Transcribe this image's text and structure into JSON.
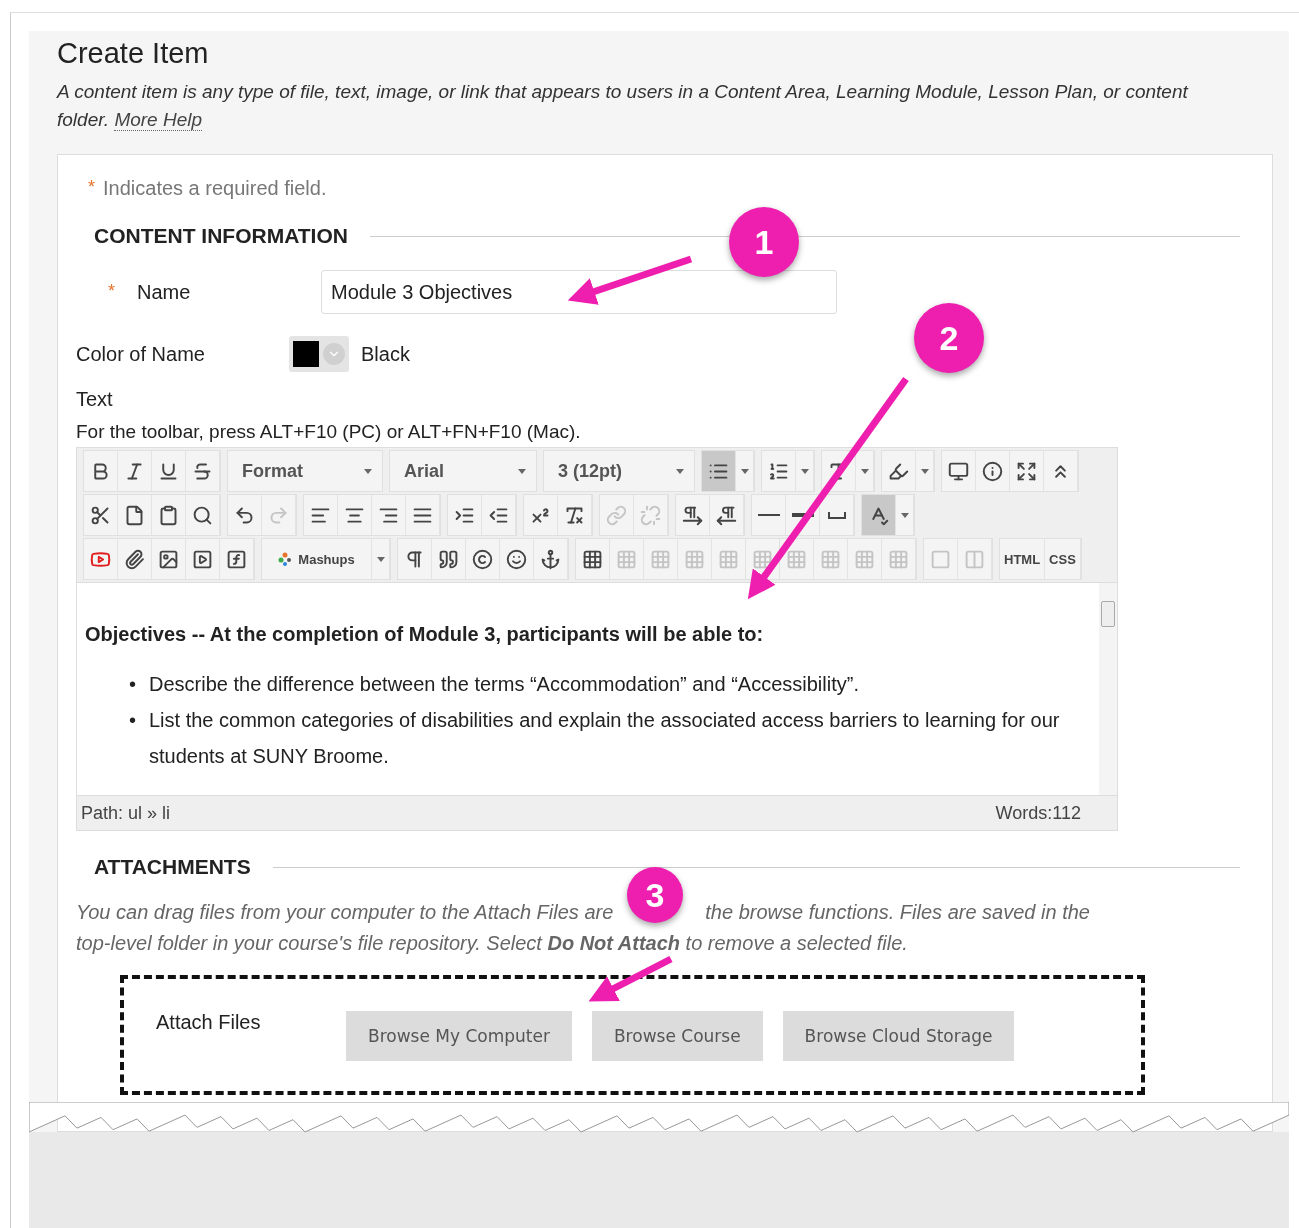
{
  "page": {
    "title": "Create Item",
    "description": "A content item is any type of file, text, image, or link that appears to users in a Content Area, Learning Module, Lesson Plan, or content folder.",
    "help_link": "More Help"
  },
  "form": {
    "required_note": {
      "mark": "*",
      "text": "Indicates a required field."
    },
    "content_section": {
      "heading": "CONTENT INFORMATION",
      "name_field": {
        "mark": "*",
        "label": "Name",
        "value": "Module 3 Objectives"
      },
      "color_field": {
        "label": "Color of Name",
        "color": "#000000",
        "value": "Black"
      },
      "text_field": {
        "label": "Text",
        "hint": "For the toolbar, press ALT+F10 (PC) or ALT+FN+F10 (Mac).",
        "toolbar": [
          [
            [
              {
                "kind": "icon",
                "disabled": false,
                "pressed": false
              },
              {
                "kind": "icon",
                "disabled": false,
                "pressed": false
              },
              {
                "kind": "icon",
                "disabled": false,
                "pressed": false
              },
              {
                "kind": "icon",
                "disabled": false,
                "pressed": false
              }
            ],
            [
              {
                "kind": "dropdown",
                "label": "Format"
              }
            ],
            [
              {
                "kind": "dropdown",
                "label": "Arial"
              }
            ],
            [
              {
                "kind": "dropdown",
                "label": "3 (12pt)"
              }
            ],
            [
              {
                "kind": "icon",
                "disabled": false,
                "pressed": true
              },
              {
                "kind": "caret"
              }
            ],
            [
              {
                "kind": "icon",
                "disabled": false,
                "pressed": false
              },
              {
                "kind": "caret"
              }
            ],
            [
              {
                "kind": "icon",
                "disabled": false,
                "pressed": false
              },
              {
                "kind": "caret"
              }
            ],
            [
              {
                "kind": "icon",
                "disabled": false,
                "pressed": false
              },
              {
                "kind": "caret"
              }
            ],
            [
              {
                "kind": "icon",
                "disabled": false,
                "pressed": false
              },
              {
                "kind": "icon",
                "disabled": false,
                "pressed": false
              },
              {
                "kind": "icon",
                "disabled": false,
                "pressed": false
              },
              {
                "kind": "icon",
                "disabled": false,
                "pressed": false
              }
            ]
          ],
          [
            [
              {
                "kind": "icon",
                "disabled": false,
                "pressed": false
              },
              {
                "kind": "icon",
                "disabled": false,
                "pressed": false
              },
              {
                "kind": "icon",
                "disabled": false,
                "pressed": false
              },
              {
                "kind": "icon",
                "disabled": false,
                "pressed": false
              }
            ],
            [
              {
                "kind": "icon",
                "disabled": false,
                "pressed": false
              },
              {
                "kind": "icon",
                "disabled": true,
                "pressed": false
              }
            ],
            [
              {
                "kind": "icon",
                "disabled": false,
                "pressed": false
              },
              {
                "kind": "icon",
                "disabled": false,
                "pressed": false
              },
              {
                "kind": "icon",
                "disabled": false,
                "pressed": false
              },
              {
                "kind": "icon",
                "disabled": false,
                "pressed": false
              }
            ],
            [
              {
                "kind": "icon",
                "disabled": false,
                "pressed": false
              },
              {
                "kind": "icon",
                "disabled": false,
                "pressed": false
              }
            ],
            [
              {
                "kind": "icon",
                "disabled": false,
                "pressed": false
              },
              {
                "kind": "icon",
                "disabled": false,
                "pressed": false
              }
            ],
            [
              {
                "kind": "icon",
                "disabled": true,
                "pressed": false
              },
              {
                "kind": "icon",
                "disabled": true,
                "pressed": false
              }
            ],
            [
              {
                "kind": "icon",
                "disabled": false,
                "pressed": false
              },
              {
                "kind": "icon",
                "disabled": false,
                "pressed": false
              }
            ],
            [
              {
                "kind": "icon",
                "disabled": false,
                "pressed": false
              },
              {
                "kind": "icon",
                "disabled": false,
                "pressed": false
              },
              {
                "kind": "icon",
                "disabled": false,
                "pressed": false
              }
            ],
            [
              {
                "kind": "icon",
                "disabled": false,
                "pressed": true
              },
              {
                "kind": "caret"
              }
            ]
          ],
          [
            [
              {
                "kind": "icon",
                "disabled": false,
                "pressed": false
              },
              {
                "kind": "icon",
                "disabled": false,
                "pressed": false
              },
              {
                "kind": "icon",
                "disabled": false,
                "pressed": false
              },
              {
                "kind": "icon",
                "disabled": false,
                "pressed": false
              },
              {
                "kind": "icon",
                "disabled": false,
                "pressed": false
              }
            ],
            [
              {
                "kind": "menu",
                "label": "Mashups"
              },
              {
                "kind": "caret"
              }
            ],
            [
              {
                "kind": "icon",
                "disabled": false,
                "pressed": false
              },
              {
                "kind": "icon",
                "disabled": false,
                "pressed": false
              },
              {
                "kind": "icon",
                "disabled": false,
                "pressed": false
              },
              {
                "kind": "icon",
                "disabled": false,
                "pressed": false
              },
              {
                "kind": "icon",
                "disabled": false,
                "pressed": false
              }
            ],
            [
              {
                "kind": "icon",
                "disabled": false,
                "pressed": false
              },
              {
                "kind": "icon",
                "disabled": true,
                "pressed": false
              },
              {
                "kind": "icon",
                "disabled": true,
                "pressed": false
              },
              {
                "kind": "icon",
                "disabled": true,
                "pressed": false
              },
              {
                "kind": "icon",
                "disabled": true,
                "pressed": false
              },
              {
                "kind": "icon",
                "disabled": true,
                "pressed": false
              },
              {
                "kind": "icon",
                "disabled": true,
                "pressed": false
              },
              {
                "kind": "icon",
                "disabled": true,
                "pressed": false
              },
              {
                "kind": "icon",
                "disabled": true,
                "pressed": false
              },
              {
                "kind": "icon",
                "disabled": true,
                "pressed": false
              }
            ],
            [
              {
                "kind": "icon",
                "disabled": true,
                "pressed": false
              },
              {
                "kind": "icon",
                "disabled": true,
                "pressed": false
              }
            ],
            [
              {
                "kind": "text",
                "label": "HTML"
              },
              {
                "kind": "text",
                "label": "CSS"
              }
            ]
          ]
        ],
        "content": {
          "heading": "Objectives -- At the completion of Module 3, participants will be able to:",
          "items": [
            {
              "marker": "•",
              "text": "Describe the difference between the terms “Accommodation” and “Accessibility”."
            },
            {
              "marker": "•",
              "text": "List the common categories of disabilities and explain the associated access barriers to learning for our students at SUNY Broome."
            }
          ]
        },
        "path": "Path: ul » li",
        "word_count": "Words:112"
      }
    },
    "attachments": {
      "heading": "ATTACHMENTS",
      "note": [
        "You can drag files from your computer to the Attach Files are",
        "the browse functions. Files are saved in the",
        "top-level folder in your course's file repository.  Select **Do Not Attach** to remove a selected file."
      ],
      "label": "Attach Files",
      "buttons": [
        "Browse My Computer",
        "Browse Course",
        "Browse Cloud Storage"
      ]
    }
  },
  "callouts": [
    {
      "number": "1"
    },
    {
      "number": "2"
    },
    {
      "number": "3"
    }
  ]
}
